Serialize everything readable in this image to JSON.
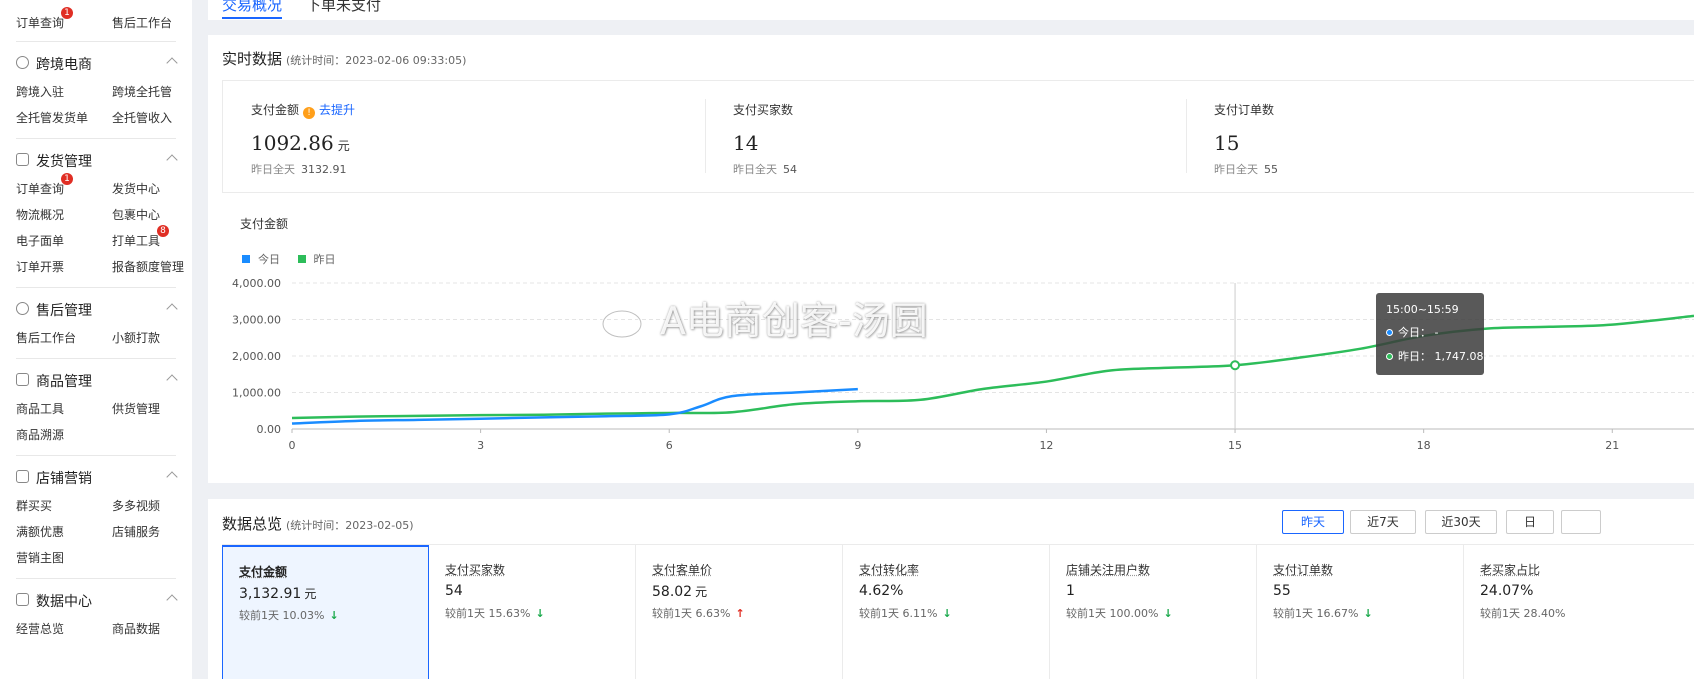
{
  "sidebar": {
    "top_links": [
      {
        "label": "订单查询",
        "badge": "1"
      },
      {
        "label": "售后工作台",
        "badge": ""
      }
    ],
    "sections": [
      {
        "title": "跨境电商",
        "icon": "globe-icon",
        "links": [
          [
            "跨境入驻",
            "跨境全托管"
          ],
          [
            "全托管发货单",
            "全托管收入"
          ]
        ]
      },
      {
        "title": "发货管理",
        "icon": "document-icon",
        "links": [
          [
            "订单查询",
            "发货中心"
          ],
          [
            "物流概况",
            "包裹中心"
          ],
          [
            "电子面单",
            "打单工具"
          ],
          [
            "订单开票",
            "报备额度管理"
          ]
        ]
      },
      {
        "title": "售后管理",
        "icon": "shield-icon",
        "links": [
          [
            "售后工作台",
            "小额打款"
          ]
        ]
      },
      {
        "title": "商品管理",
        "icon": "image-icon",
        "links": [
          [
            "商品工具",
            "供货管理"
          ],
          [
            "商品溯源",
            ""
          ]
        ]
      },
      {
        "title": "店铺营销",
        "icon": "store-icon",
        "links": [
          [
            "群买买",
            "多多视频"
          ],
          [
            "满额优惠",
            "店铺服务"
          ],
          [
            "营销主图",
            ""
          ]
        ]
      },
      {
        "title": "数据中心",
        "icon": "chart-icon",
        "links": []
      }
    ],
    "badges": {
      "order_query": "1",
      "print_tool": "8"
    },
    "partial_bottom": [
      "经营总览",
      "商品数据"
    ]
  },
  "tabs": [
    {
      "label": "交易概况",
      "active": true
    },
    {
      "label": "下单未支付",
      "active": false
    }
  ],
  "realtime": {
    "title": "实时数据",
    "subtitle": "(统计时间：2023-02-06 09:33:05)",
    "kpis": [
      {
        "label": "支付金额",
        "value": "1092.86",
        "unit": "元",
        "prev_label": "昨日全天",
        "prev_value": "3132.91",
        "link": "去提升"
      },
      {
        "label": "支付买家数",
        "value": "14",
        "unit": "",
        "prev_label": "昨日全天",
        "prev_value": "54",
        "link": ""
      },
      {
        "label": "支付订单数",
        "value": "15",
        "unit": "",
        "prev_label": "昨日全天",
        "prev_value": "55",
        "link": ""
      }
    ],
    "chart_title": "支付金额",
    "tooltip": {
      "time": "15:00~15:59",
      "today_label": "今日：",
      "today_value": "-",
      "yesterday_label": "昨日：",
      "yesterday_value": "1,747.08"
    }
  },
  "chart_data": {
    "type": "line",
    "title": "支付金额",
    "xlabel": "",
    "ylabel": "",
    "x_ticks": [
      0,
      3,
      6,
      9,
      12,
      15,
      18,
      21
    ],
    "y_ticks": [
      "0.00",
      "1,000.00",
      "2,000.00",
      "3,000.00",
      "4,000.00"
    ],
    "ylim": [
      0,
      4000
    ],
    "xlim": [
      0,
      22.3
    ],
    "grid": true,
    "legend_position": "top-left",
    "series": [
      {
        "name": "今日",
        "color": "#1a8cff",
        "x": [
          0,
          1,
          2,
          3,
          4,
          5,
          6,
          6.5,
          7,
          8,
          9
        ],
        "values": [
          150,
          220,
          250,
          280,
          320,
          350,
          400,
          620,
          900,
          1000,
          1092.86
        ]
      },
      {
        "name": "昨日",
        "color": "#2dbd5a",
        "x": [
          0,
          1,
          2,
          3,
          4,
          5,
          6,
          7,
          8,
          9,
          10,
          11,
          12,
          13,
          14,
          15,
          16,
          17,
          18,
          19,
          20,
          21,
          22.3
        ],
        "values": [
          300,
          340,
          360,
          380,
          390,
          420,
          440,
          460,
          680,
          760,
          800,
          1100,
          1300,
          1600,
          1680,
          1747.08,
          1950,
          2200,
          2550,
          2750,
          2800,
          2860,
          3100
        ]
      }
    ],
    "hover_x": 15
  },
  "overview": {
    "title": "数据总览",
    "subtitle": "(统计时间：2023-02-05)",
    "buttons": [
      "昨天",
      "近7天",
      "近30天",
      "日"
    ],
    "cells": [
      {
        "label": "支付金额",
        "value": "3,132.91",
        "unit": "元",
        "cmp_label": "较前1天",
        "cmp_value": "10.03%",
        "trend": "down"
      },
      {
        "label": "支付买家数",
        "value": "54",
        "unit": "",
        "cmp_label": "较前1天",
        "cmp_value": "15.63%",
        "trend": "down"
      },
      {
        "label": "支付客单价",
        "value": "58.02",
        "unit": "元",
        "cmp_label": "较前1天",
        "cmp_value": "6.63%",
        "trend": "up"
      },
      {
        "label": "支付转化率",
        "value": "4.62%",
        "unit": "",
        "cmp_label": "较前1天",
        "cmp_value": "6.11%",
        "trend": "down"
      },
      {
        "label": "店铺关注用户数",
        "value": "1",
        "unit": "",
        "cmp_label": "较前1天",
        "cmp_value": "100.00%",
        "trend": "down"
      },
      {
        "label": "支付订单数",
        "value": "55",
        "unit": "",
        "cmp_label": "较前1天",
        "cmp_value": "16.67%",
        "trend": "down"
      },
      {
        "label": "老买家占比",
        "value": "24.07%",
        "unit": "",
        "cmp_label": "较前1天",
        "cmp_value": "28.40%",
        "trend": ""
      }
    ]
  },
  "watermark": "A电商创客-汤圆",
  "colors": {
    "accent": "#1a66ff",
    "today": "#1a8cff",
    "yesterday": "#2dbd5a",
    "down": "#19a94b",
    "up": "#e02e24"
  }
}
